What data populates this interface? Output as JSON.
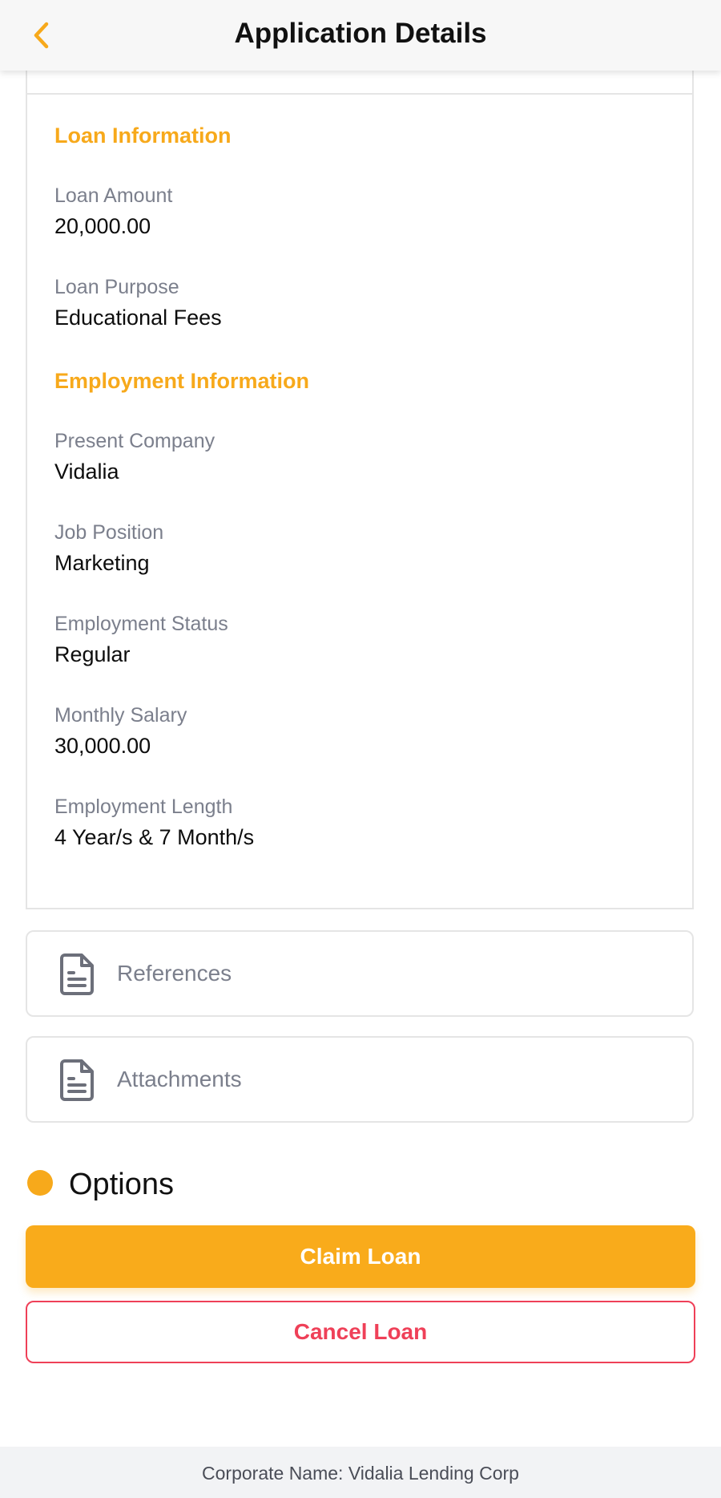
{
  "header": {
    "title": "Application Details",
    "back_icon": "chevron-left-icon",
    "accent_color": "#f7a91b"
  },
  "loan_information": {
    "title": "Loan Information",
    "fields": [
      {
        "label": "Loan Amount",
        "value": "20,000.00"
      },
      {
        "label": "Loan Purpose",
        "value": "Educational Fees"
      }
    ]
  },
  "employment_information": {
    "title": "Employment Information",
    "fields": [
      {
        "label": "Present Company",
        "value": "Vidalia"
      },
      {
        "label": "Job Position",
        "value": "Marketing"
      },
      {
        "label": "Employment Status",
        "value": "Regular"
      },
      {
        "label": "Monthly Salary",
        "value": "30,000.00"
      },
      {
        "label": "Employment Length",
        "value": "4 Year/s & 7 Month/s"
      }
    ]
  },
  "accordions": [
    {
      "label": "References",
      "icon": "document-icon"
    },
    {
      "label": "Attachments",
      "icon": "document-icon"
    }
  ],
  "options": {
    "title": "Options",
    "claim_label": "Claim Loan",
    "cancel_label": "Cancel Loan",
    "claim_color": "#f9ab1b",
    "cancel_color": "#ef4058"
  },
  "footer": {
    "text": "Corporate Name: Vidalia Lending Corp"
  }
}
